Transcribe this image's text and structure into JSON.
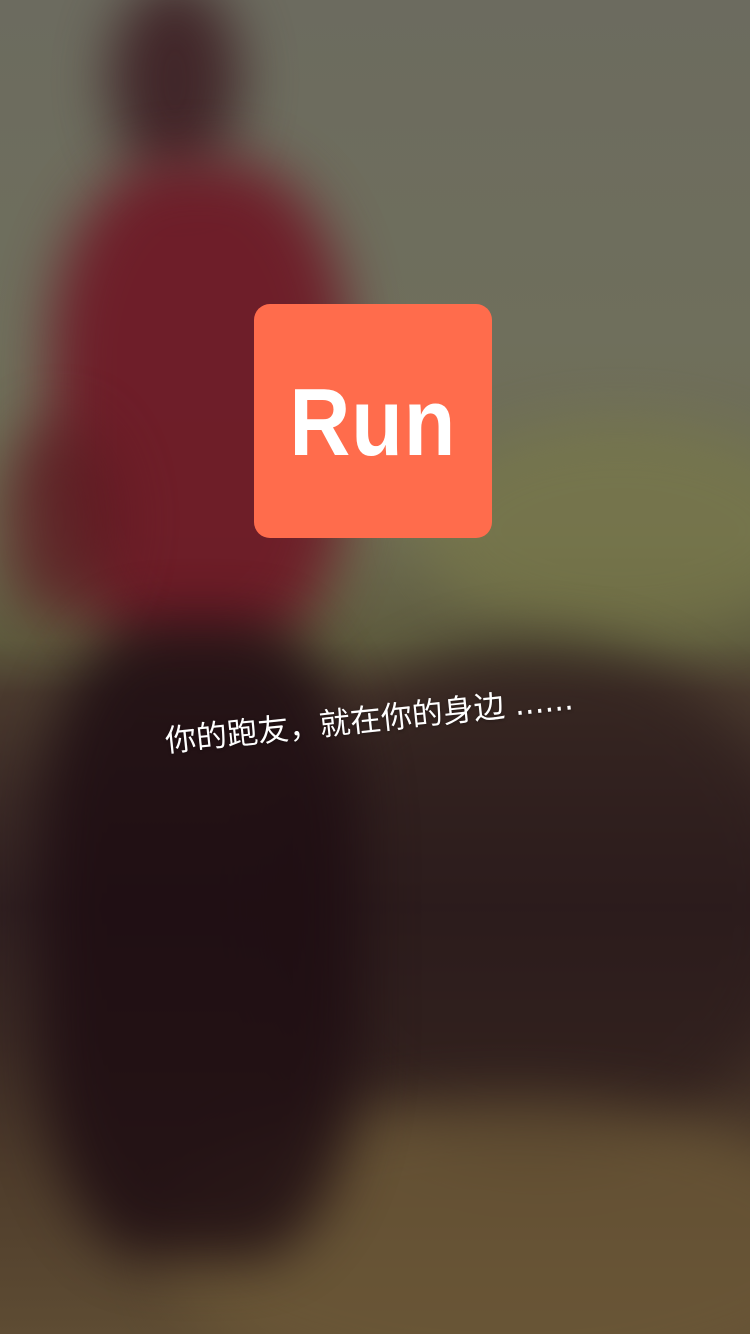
{
  "splash": {
    "logo_text": "Run",
    "tagline": "你的跑友，就在你的身边 ......"
  },
  "colors": {
    "logo_background": "#ff6c4c",
    "logo_text": "#ffffff",
    "tagline_text": "#ffffff"
  },
  "background": {
    "image": "blurred-runner-photo"
  }
}
